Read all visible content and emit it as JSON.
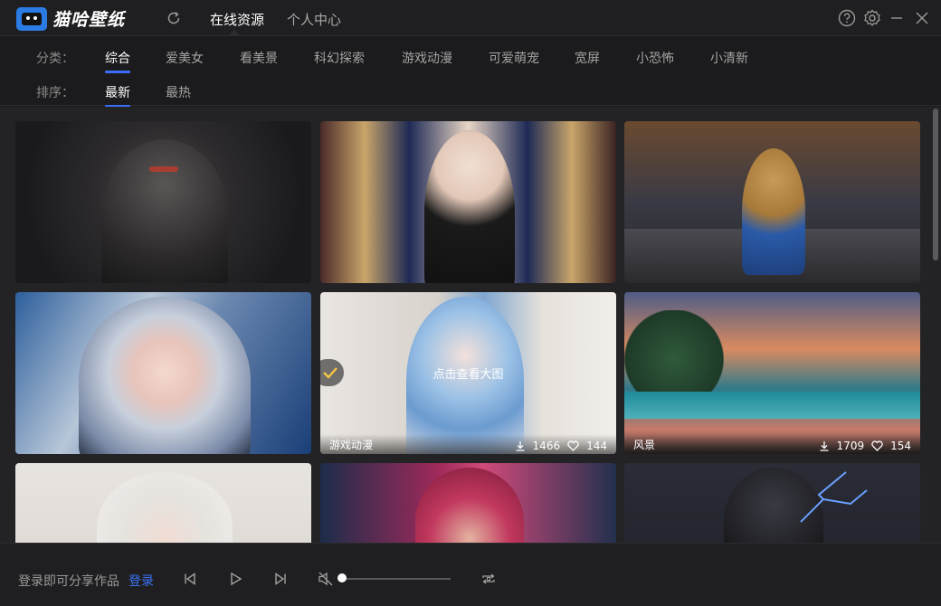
{
  "app": {
    "name": "猫哈壁纸"
  },
  "nav": {
    "tabs": [
      {
        "label": "在线资源",
        "active": true
      },
      {
        "label": "个人中心",
        "active": false
      }
    ]
  },
  "filters": {
    "category_label": "分类：",
    "categories": [
      {
        "label": "综合",
        "active": true
      },
      {
        "label": "爱美女",
        "active": false
      },
      {
        "label": "看美景",
        "active": false
      },
      {
        "label": "科幻探索",
        "active": false
      },
      {
        "label": "游戏动漫",
        "active": false
      },
      {
        "label": "可爱萌宠",
        "active": false
      },
      {
        "label": "宽屏",
        "active": false
      },
      {
        "label": "小恐怖",
        "active": false
      },
      {
        "label": "小清新",
        "active": false
      }
    ],
    "sort_label": "排序：",
    "sorts": [
      {
        "label": "最新",
        "active": true
      },
      {
        "label": "最热",
        "active": false
      }
    ]
  },
  "wallpapers": [
    {
      "subject": "dark-armored-knight"
    },
    {
      "subject": "girl-in-ornate-hall"
    },
    {
      "subject": "cartoon-giraffe-with-headphones"
    },
    {
      "subject": "silver-haired-cat-girl"
    },
    {
      "subject": "blue-haired-demon-girl",
      "hover_text": "点击查看大图",
      "tag": "游戏动漫",
      "downloads": "1466",
      "likes": "144"
    },
    {
      "subject": "beach-sunset",
      "tag": "风景",
      "downloads": "1709",
      "likes": "154"
    },
    {
      "subject": "white-haired-girl"
    },
    {
      "subject": "pink-haired-cyberpunk-girl"
    },
    {
      "subject": "dark-knight-lightning"
    }
  ],
  "player": {
    "login_tip": "登录即可分享作品",
    "login_link": "登录",
    "volume_level": 0
  },
  "colors": {
    "accent": "#3b6cf6",
    "background": "#1b1b1d"
  }
}
